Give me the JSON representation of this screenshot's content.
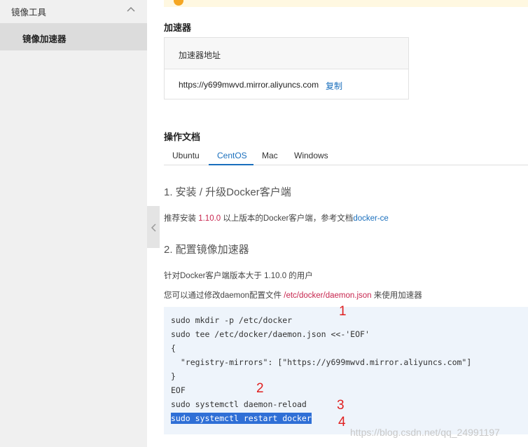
{
  "sidebar": {
    "section_label": "镜像工具",
    "items": [
      {
        "label": "镜像加速器"
      }
    ]
  },
  "accelerator": {
    "title": "加速器",
    "table_header": "加速器地址",
    "url": "https://y699mwvd.mirror.aliyuncs.com",
    "copy_label": "复制"
  },
  "docs": {
    "title": "操作文档",
    "tabs": [
      {
        "label": "Ubuntu"
      },
      {
        "label": "CentOS"
      },
      {
        "label": "Mac"
      },
      {
        "label": "Windows"
      }
    ],
    "active_tab": "CentOS",
    "step1": {
      "heading": "1. 安装 / 升级Docker客户端",
      "text_before": "推荐安装 ",
      "version": "1.10.0",
      "text_after": " 以上版本的Docker客户端，参考文档",
      "link": "docker-ce"
    },
    "step2": {
      "heading": "2. 配置镜像加速器",
      "line1": "针对Docker客户端版本大于 1.10.0 的用户",
      "line2_before": "您可以通过修改daemon配置文件 ",
      "line2_path": "/etc/docker/daemon.json",
      "line2_after": " 来使用加速器"
    },
    "code_lines": [
      "sudo mkdir -p /etc/docker",
      "sudo tee /etc/docker/daemon.json <<-'EOF'",
      "{",
      "  \"registry-mirrors\": [\"https://y699mwvd.mirror.aliyuncs.com\"]",
      "}",
      "EOF",
      "sudo systemctl daemon-reload",
      "sudo systemctl restart docker"
    ]
  },
  "annotations": [
    "1",
    "2",
    "3",
    "4"
  ],
  "watermark": "https://blog.csdn.net/qq_24991197",
  "colors": {
    "accent": "#1a6fbd",
    "highlight": "#2f6fd6",
    "annotation": "#e01f1f",
    "version_red": "#c7254e"
  }
}
